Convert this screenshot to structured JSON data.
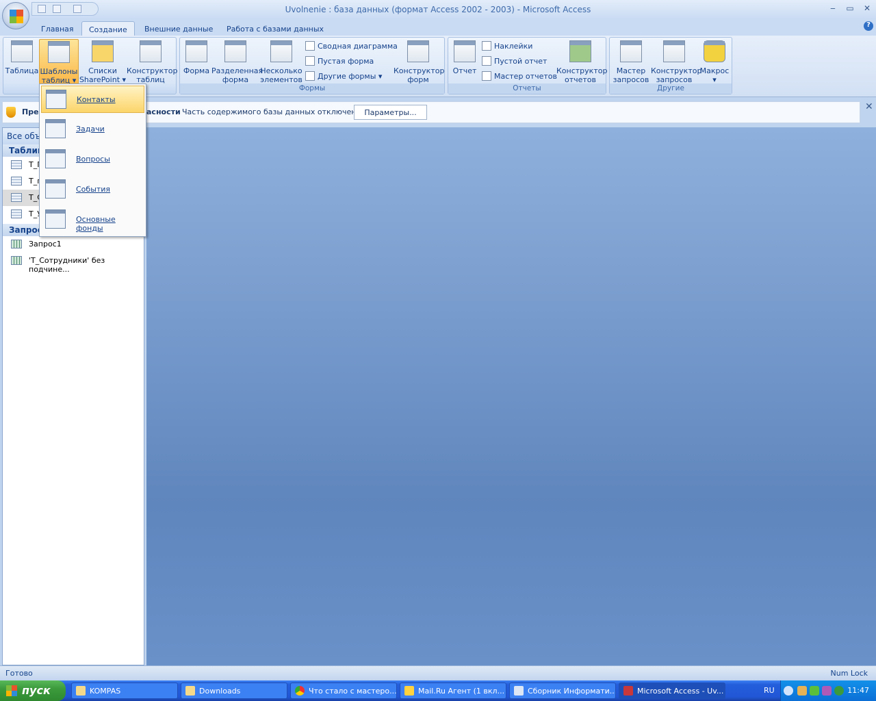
{
  "window": {
    "title": "Uvolnenie : база данных (формат Access 2002 - 2003) - Microsoft Access",
    "minimize": "‒",
    "restore": "▭",
    "close": "✕"
  },
  "tabs": [
    {
      "label": "Главная"
    },
    {
      "label": "Создание",
      "active": true
    },
    {
      "label": "Внешние данные"
    },
    {
      "label": "Работа с базами данных"
    }
  ],
  "ribbon": {
    "tables": {
      "table": "Таблица",
      "templates": "Шаблоны таблиц ▾",
      "sharepoint": "Списки SharePoint ▾",
      "designer": "Конструктор таблиц"
    },
    "forms": {
      "label": "Формы",
      "form": "Форма",
      "split": "Разделенная форма",
      "multiple": "Несколько элементов",
      "pivot_chart": "Сводная диаграмма",
      "blank": "Пустая форма",
      "other": "Другие формы ▾",
      "designer": "Конструктор форм"
    },
    "reports": {
      "label": "Отчеты",
      "report": "Отчет",
      "labels": "Наклейки",
      "blank": "Пустой отчет",
      "wizard": "Мастер отчетов",
      "designer": "Конструктор отчетов"
    },
    "other": {
      "label": "Другие",
      "query_wizard": "Мастер запросов",
      "query_designer": "Конструктор запросов",
      "macro": "Макрос ▾"
    }
  },
  "template_menu": [
    "Контакты",
    "Задачи",
    "Вопросы",
    "События",
    "Основные фонды"
  ],
  "security_bar": {
    "title": "Пред",
    "title_end": "асности",
    "message": "Часть содержимого базы данных отключено",
    "button": "Параметры..."
  },
  "nav": {
    "header": "Все объ",
    "tables_section": "Таблиц",
    "tables": [
      "Т_П",
      "Т_п",
      "Т_С",
      "Т_У"
    ],
    "queries_section": "Запросы",
    "queries": [
      "Запрос1",
      "'Т_Сотрудники' без подчине..."
    ]
  },
  "status": {
    "left": "Готово",
    "right": "Num Lock"
  },
  "taskbar": {
    "start": "пуск",
    "items": [
      "KOMPAS",
      "Downloads",
      "Что стало с мастеро...",
      "Mail.Ru Агент (1 вкл...",
      "Сборник Информати...",
      "Microsoft Access - Uv..."
    ],
    "lang": "RU",
    "clock": "11:47"
  }
}
